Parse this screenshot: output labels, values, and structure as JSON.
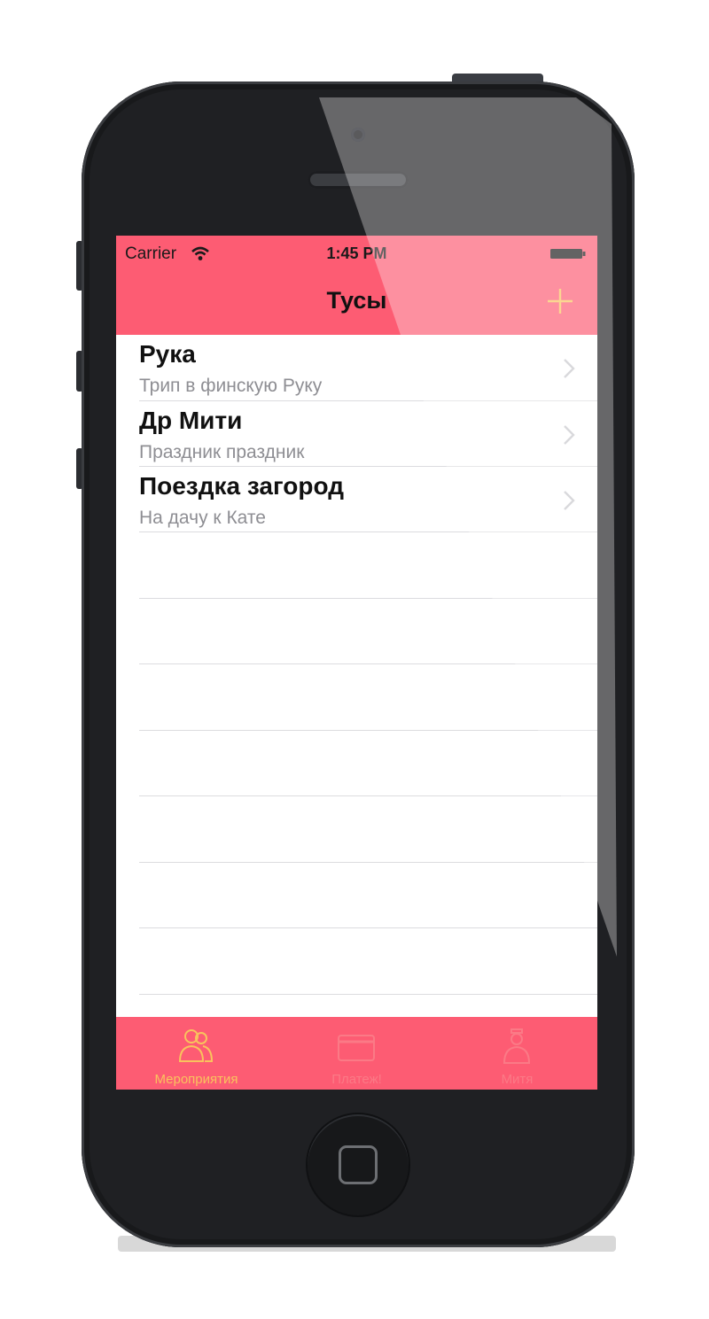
{
  "status_bar": {
    "carrier": "Carrier",
    "time": "1:45 PM",
    "icons": [
      "wifi-icon",
      "battery-icon"
    ]
  },
  "nav_bar": {
    "title": "Тусы",
    "add_icon": "plus-icon"
  },
  "events": [
    {
      "title": "Рука",
      "subtitle": "Трип в финскую Руку"
    },
    {
      "title": "Др Мити",
      "subtitle": "Праздник праздник"
    },
    {
      "title": "Поездка загород",
      "subtitle": "На дачу к Кате"
    }
  ],
  "tab_bar": {
    "selected": "events",
    "tabs": [
      {
        "label": "Мероприятия",
        "icon": "people-icon"
      },
      {
        "label": "Платеж!",
        "icon": "card-icon"
      },
      {
        "label": "Митя",
        "icon": "person-icon"
      }
    ]
  },
  "colors": {
    "brand": "#fd5c73",
    "accent": "#f9c35d",
    "separator": "#dcdcdf",
    "subtitle": "#8e8e93"
  }
}
